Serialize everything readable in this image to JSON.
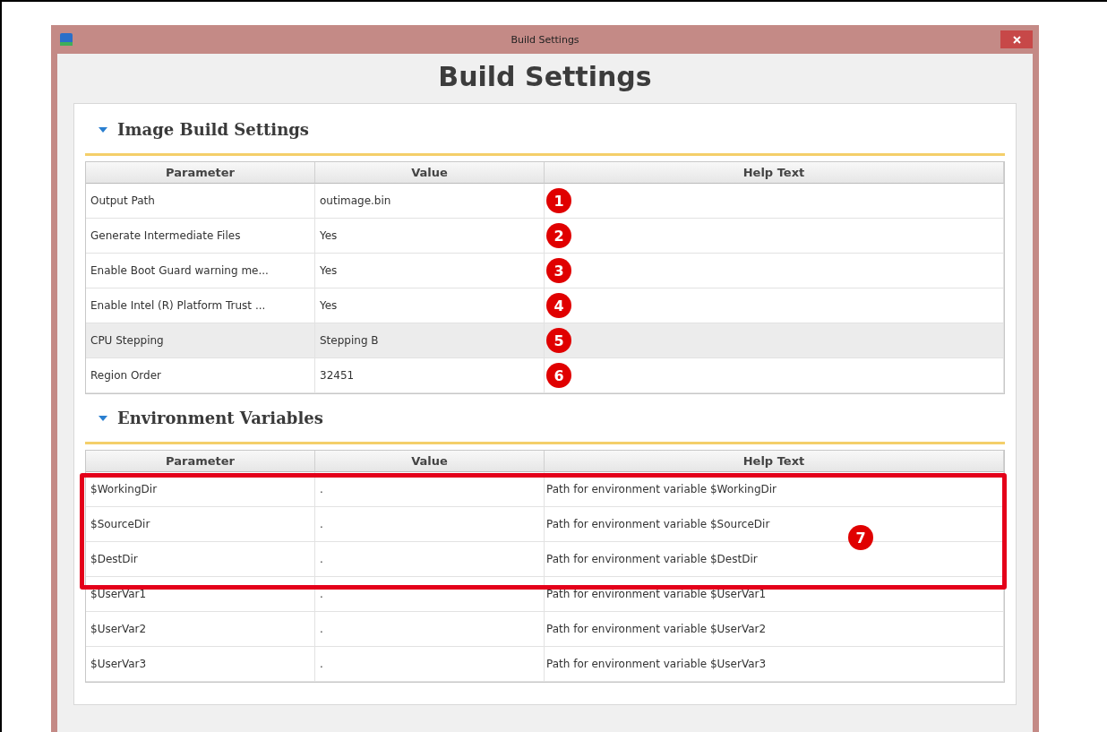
{
  "window": {
    "title": "Build Settings"
  },
  "heading": "Build Settings",
  "sections": [
    {
      "title": "Image Build Settings",
      "expanded": true,
      "columns": [
        "Parameter",
        "Value",
        "Help Text"
      ],
      "rows": [
        {
          "parameter": "Output Path",
          "value": "outimage.bin",
          "marker": "1",
          "selected": false
        },
        {
          "parameter": "Generate Intermediate Files",
          "value": "Yes",
          "marker": "2",
          "selected": false
        },
        {
          "parameter": "Enable Boot Guard warning me...",
          "value": "Yes",
          "marker": "3",
          "selected": false
        },
        {
          "parameter": "Enable Intel (R) Platform Trust ...",
          "value": "Yes",
          "marker": "4",
          "selected": false
        },
        {
          "parameter": "CPU Stepping",
          "value": "Stepping B",
          "marker": "5",
          "selected": true
        },
        {
          "parameter": "Region Order",
          "value": "32451",
          "marker": "6",
          "selected": false
        }
      ]
    },
    {
      "title": "Environment Variables",
      "expanded": true,
      "columns": [
        "Parameter",
        "Value",
        "Help Text"
      ],
      "highlight": {
        "label": "7"
      },
      "rows": [
        {
          "parameter": "$WorkingDir",
          "value": ".",
          "help": "Path for environment variable $WorkingDir",
          "selected": false
        },
        {
          "parameter": "$SourceDir",
          "value": ".",
          "help": "Path for environment variable $SourceDir",
          "selected": false
        },
        {
          "parameter": "$DestDir",
          "value": ".",
          "help": "Path for environment variable $DestDir",
          "selected": false
        },
        {
          "parameter": "$UserVar1",
          "value": ".",
          "help": "Path for environment variable $UserVar1",
          "selected": false
        },
        {
          "parameter": "$UserVar2",
          "value": ".",
          "help": "Path for environment variable $UserVar2",
          "selected": false
        },
        {
          "parameter": "$UserVar3",
          "value": ".",
          "help": "Path for environment variable $UserVar3",
          "selected": false
        }
      ]
    }
  ]
}
